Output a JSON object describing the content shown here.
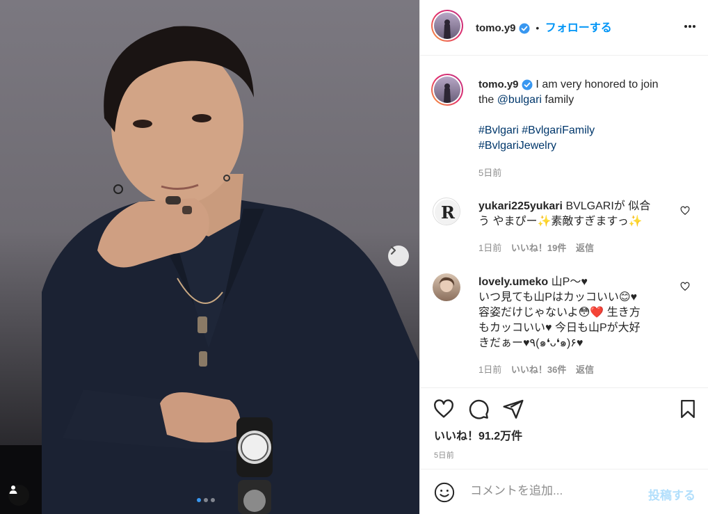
{
  "post": {
    "username": "tomo.y9",
    "header_separator": "•",
    "follow_label": "フォローする",
    "caption_text_1": "I am very honored to join",
    "caption_text_2a": "the ",
    "caption_mention": "@bulgari",
    "caption_text_2b": " family",
    "hashtag_1": "#Bvlgari",
    "hashtag_2": "#BvlgariFamily",
    "hashtag_3": "#BvlgariJewelry",
    "caption_age": "5日前",
    "carousel": {
      "slide_count": 3,
      "active_index": 0
    }
  },
  "comments": [
    {
      "username": "yukari225yukari",
      "line1": "BVLGARIが 似合",
      "line2": "う やまぴー✨素敵すぎますっ✨",
      "age": "1日前",
      "likes": "いいね！19件",
      "reply": "返信"
    },
    {
      "username": "lovely.umeko",
      "line1": "山P〜♥",
      "line2": "いつ見ても山Pはカッコいい😊♥",
      "line3": "容姿だけじゃないよ😳❤️ 生き方",
      "line4": "もカッコいい♥ 今日も山Pが大好",
      "line5": "きだぁー♥٩(๑❛ᴗ❛๑)۶♥",
      "age": "1日前",
      "likes": "いいね！36件",
      "reply": "返信"
    }
  ],
  "footer": {
    "likes_count": "いいね！91.2万件",
    "age": "5日前",
    "comment_placeholder": "コメントを追加...",
    "post_label": "投稿する"
  },
  "icons": {
    "verified": "verified-badge-icon",
    "more": "more-options-icon",
    "like": "heart-icon",
    "comment": "comment-bubble-icon",
    "share": "paper-plane-icon",
    "save": "bookmark-icon",
    "emoji": "emoji-icon",
    "next": "chevron-right-icon",
    "tag": "user-tag-icon"
  },
  "colors": {
    "accent": "#0095f6",
    "link": "#00376b",
    "muted": "#8e8e8e",
    "verified": "#3897f0"
  }
}
